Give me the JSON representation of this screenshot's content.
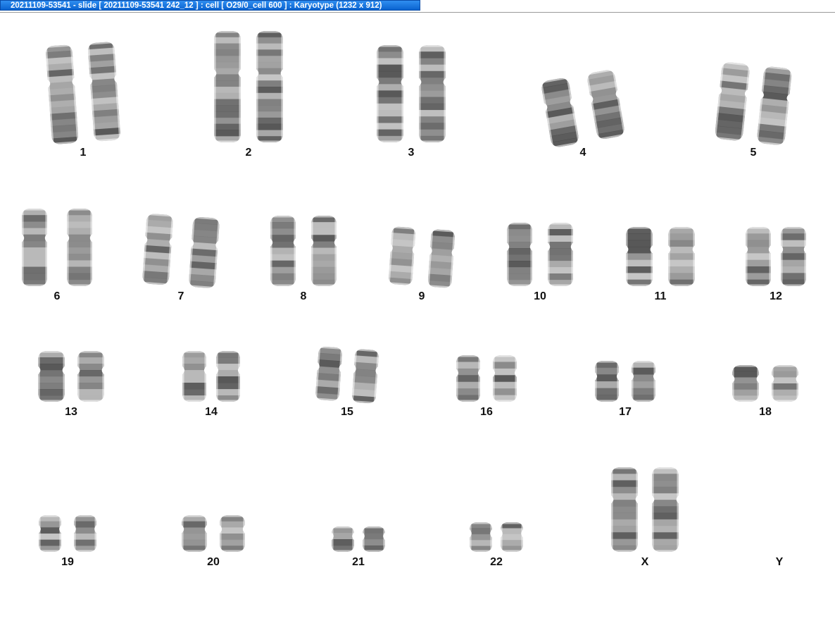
{
  "window": {
    "title": "20211109-53541 - slide [ 20211109-53541 242_12 ] : cell [ O29/0_cell 600 ] : Karyotype  (1232 x 912)"
  },
  "karyotype": {
    "labels": [
      "1",
      "2",
      "3",
      "4",
      "5",
      "6",
      "7",
      "8",
      "9",
      "10",
      "11",
      "12",
      "13",
      "14",
      "15",
      "16",
      "17",
      "18",
      "19",
      "20",
      "21",
      "22",
      "X",
      "Y"
    ]
  },
  "colors": {
    "titlebar_active": "#0a63d0",
    "chromosome_dark": "#3a3a3a",
    "chromosome_light": "#b8b8b8"
  }
}
